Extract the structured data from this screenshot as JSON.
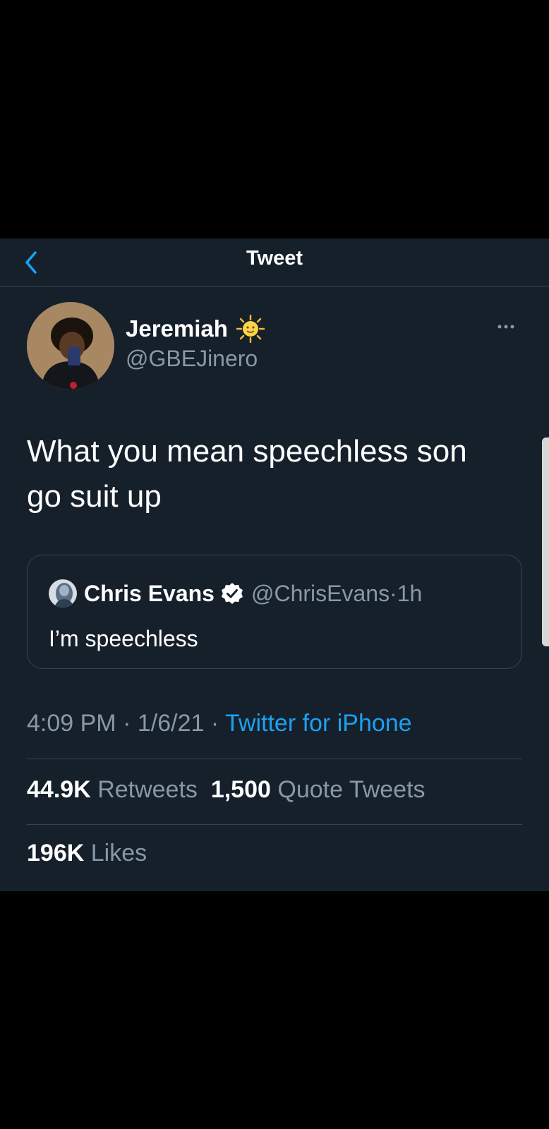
{
  "header": {
    "title": "Tweet",
    "back_icon": "chevron-left-icon",
    "accent": "#1da1f2"
  },
  "tweet": {
    "author_name": "Jeremiah",
    "author_emoji_icon": "sun-with-face-icon",
    "author_handle": "@GBEJinero",
    "more_icon": "ellipsis-icon",
    "text_line1": "What you mean speechless son",
    "text_line2": "go suit up",
    "quoted": {
      "author_name": "Chris Evans",
      "verified_icon": "verified-badge-icon",
      "author_handle": "@ChrisEvans",
      "separator": "·",
      "age": "1h",
      "text": "I’m speechless"
    },
    "time": "4:09 PM",
    "date": "1/6/21",
    "separator": "·",
    "source": "Twitter for iPhone",
    "retweets_count": "44.9K",
    "retweets_label": "Retweets",
    "quote_count": "1,500",
    "quote_label": "Quote Tweets",
    "likes_count": "196K",
    "likes_label": "Likes"
  },
  "colors": {
    "background": "#15202b",
    "border": "#38444d",
    "secondary_text": "#8899a6",
    "link": "#1da1f2"
  }
}
